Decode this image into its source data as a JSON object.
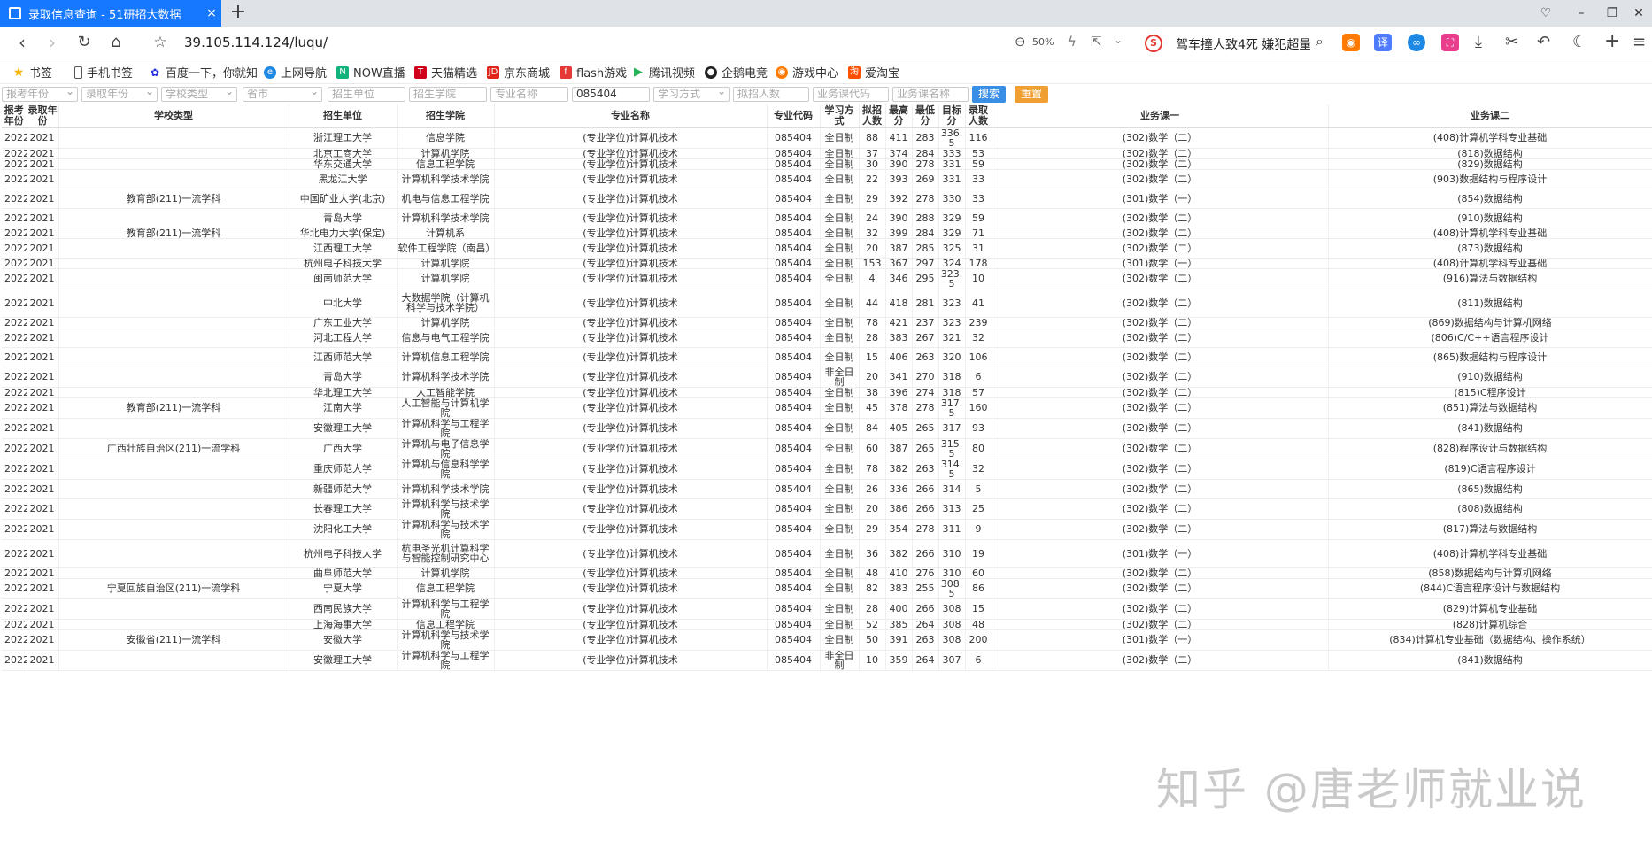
{
  "browser": {
    "tab_title": "录取信息查询 - 51研招大数据",
    "tab_close": "×",
    "new_tab": "+",
    "url": "39.105.114.124/luqu/",
    "zoom": "50%",
    "news": "驾车撞人致4死 嫌犯超量服",
    "window_controls": [
      "♡",
      "–",
      "❐",
      "✕"
    ]
  },
  "bookmarks": [
    {
      "label": "书签",
      "icon": "star-icon",
      "color": "#f5b301"
    },
    {
      "label": "手机书签",
      "icon": "phone-icon",
      "color": "#555555"
    },
    {
      "label": "百度一下，你就知",
      "icon": "baidu-icon",
      "color": "#2932e1"
    },
    {
      "label": "上网导航",
      "icon": "e-icon",
      "color": "#1e88e5"
    },
    {
      "label": "NOW直播",
      "icon": "now-icon",
      "color": "#11b27c"
    },
    {
      "label": "天猫精选",
      "icon": "tmall-icon",
      "color": "#d0021b"
    },
    {
      "label": "京东商城",
      "icon": "jd-icon",
      "color": "#e1251b"
    },
    {
      "label": "flash游戏",
      "icon": "flash-icon",
      "color": "#e53935"
    },
    {
      "label": "腾讯视频",
      "icon": "play-icon",
      "color": "#21b356"
    },
    {
      "label": "企鹅电竞",
      "icon": "penguin-icon",
      "color": "#222222"
    },
    {
      "label": "游戏中心",
      "icon": "gamepad-icon",
      "color": "#ff7a00"
    },
    {
      "label": "爱淘宝",
      "icon": "taobao-icon",
      "color": "#ff5000"
    }
  ],
  "filters": {
    "exam_year": "报考年份",
    "admit_year": "录取年份",
    "school_type": "学校类型",
    "province": "省市",
    "unit": "招生单位",
    "college": "招生学院",
    "major_name": "专业名称",
    "major_code": "085404",
    "study_mode": "学习方式",
    "planned": "拟招人数",
    "course_code": "业务课代码",
    "course_name": "业务课名称",
    "search": "搜索",
    "reset": "重置"
  },
  "table": {
    "headers": [
      "报考年份",
      "录取年份",
      "学校类型",
      "招生单位",
      "招生学院",
      "专业名称",
      "专业代码",
      "学习方式",
      "拟招人数",
      "最高分",
      "最低分",
      "目标分",
      "录取人数",
      "业务课一",
      "业务课二"
    ],
    "rows": [
      [
        "2022",
        "2021",
        "",
        "浙江理工大学",
        "信息学院",
        "(专业学位)计算机技术",
        "085404",
        "全日制",
        "88",
        "411",
        "283",
        "336.5",
        "116",
        "(302)数学（二）",
        "(408)计算机学科专业基础"
      ],
      [
        "2022",
        "2021",
        "",
        "北京工商大学",
        "计算机学院",
        "(专业学位)计算机技术",
        "085404",
        "全日制",
        "37",
        "374",
        "284",
        "333",
        "53",
        "(302)数学（二）",
        "(818)数据结构"
      ],
      [
        "2022",
        "2021",
        "",
        "华东交通大学",
        "信息工程学院",
        "(专业学位)计算机技术",
        "085404",
        "全日制",
        "30",
        "390",
        "278",
        "331",
        "59",
        "(302)数学（二）",
        "(829)数据结构"
      ],
      [
        "2022",
        "2021",
        "",
        "黑龙江大学",
        "计算机科学技术学院",
        "(专业学位)计算机技术",
        "085404",
        "全日制",
        "22",
        "393",
        "269",
        "331",
        "33",
        "(302)数学（二）",
        "(903)数据结构与程序设计"
      ],
      [
        "2022",
        "2021",
        "教育部(211)一流学科",
        "中国矿业大学(北京)",
        "机电与信息工程学院",
        "(专业学位)计算机技术",
        "085404",
        "全日制",
        "29",
        "392",
        "278",
        "330",
        "33",
        "(301)数学（一）",
        "(854)数据结构"
      ],
      [
        "2022",
        "2021",
        "",
        "青岛大学",
        "计算机科学技术学院",
        "(专业学位)计算机技术",
        "085404",
        "全日制",
        "24",
        "390",
        "288",
        "329",
        "59",
        "(302)数学（二）",
        "(910)数据结构"
      ],
      [
        "2022",
        "2021",
        "教育部(211)一流学科",
        "华北电力大学(保定)",
        "计算机系",
        "(专业学位)计算机技术",
        "085404",
        "全日制",
        "32",
        "399",
        "284",
        "329",
        "71",
        "(302)数学（二）",
        "(408)计算机学科专业基础"
      ],
      [
        "2022",
        "2021",
        "",
        "江西理工大学",
        "软件工程学院（南昌）",
        "(专业学位)计算机技术",
        "085404",
        "全日制",
        "20",
        "387",
        "285",
        "325",
        "31",
        "(302)数学（二）",
        "(873)数据结构"
      ],
      [
        "2022",
        "2021",
        "",
        "杭州电子科技大学",
        "计算机学院",
        "(专业学位)计算机技术",
        "085404",
        "全日制",
        "153",
        "367",
        "297",
        "324",
        "178",
        "(301)数学（一）",
        "(408)计算机学科专业基础"
      ],
      [
        "2022",
        "2021",
        "",
        "闽南师范大学",
        "计算机学院",
        "(专业学位)计算机技术",
        "085404",
        "全日制",
        "4",
        "346",
        "295",
        "323.5",
        "10",
        "(302)数学（二）",
        "(916)算法与数据结构"
      ],
      [
        "2022",
        "2021",
        "",
        "中北大学",
        "大数据学院（计算机科学与技术学院）",
        "(专业学位)计算机技术",
        "085404",
        "全日制",
        "44",
        "418",
        "281",
        "323",
        "41",
        "(302)数学（二）",
        "(811)数据结构"
      ],
      [
        "2022",
        "2021",
        "",
        "广东工业大学",
        "计算机学院",
        "(专业学位)计算机技术",
        "085404",
        "全日制",
        "78",
        "421",
        "237",
        "323",
        "239",
        "(302)数学（二）",
        "(869)数据结构与计算机网络"
      ],
      [
        "2022",
        "2021",
        "",
        "河北工程大学",
        "信息与电气工程学院",
        "(专业学位)计算机技术",
        "085404",
        "全日制",
        "28",
        "383",
        "267",
        "321",
        "32",
        "(302)数学（二）",
        "(806)C/C++语言程序设计"
      ],
      [
        "2022",
        "2021",
        "",
        "江西师范大学",
        "计算机信息工程学院",
        "(专业学位)计算机技术",
        "085404",
        "全日制",
        "15",
        "406",
        "263",
        "320",
        "106",
        "(302)数学（二）",
        "(865)数据结构与程序设计"
      ],
      [
        "2022",
        "2021",
        "",
        "青岛大学",
        "计算机科学技术学院",
        "(专业学位)计算机技术",
        "085404",
        "非全日制",
        "20",
        "341",
        "270",
        "318",
        "6",
        "(302)数学（二）",
        "(910)数据结构"
      ],
      [
        "2022",
        "2021",
        "",
        "华北理工大学",
        "人工智能学院",
        "(专业学位)计算机技术",
        "085404",
        "全日制",
        "38",
        "396",
        "274",
        "318",
        "57",
        "(302)数学（二）",
        "(815)C程序设计"
      ],
      [
        "2022",
        "2021",
        "教育部(211)一流学科",
        "江南大学",
        "人工智能与计算机学院",
        "(专业学位)计算机技术",
        "085404",
        "全日制",
        "45",
        "378",
        "278",
        "317.5",
        "160",
        "(302)数学（二）",
        "(851)算法与数据结构"
      ],
      [
        "2022",
        "2021",
        "",
        "安徽理工大学",
        "计算机科学与工程学院",
        "(专业学位)计算机技术",
        "085404",
        "全日制",
        "84",
        "405",
        "265",
        "317",
        "93",
        "(302)数学（二）",
        "(841)数据结构"
      ],
      [
        "2022",
        "2021",
        "广西壮族自治区(211)一流学科",
        "广西大学",
        "计算机与电子信息学院",
        "(专业学位)计算机技术",
        "085404",
        "全日制",
        "60",
        "387",
        "265",
        "315.5",
        "80",
        "(302)数学（二）",
        "(828)程序设计与数据结构"
      ],
      [
        "2022",
        "2021",
        "",
        "重庆师范大学",
        "计算机与信息科学学院",
        "(专业学位)计算机技术",
        "085404",
        "全日制",
        "78",
        "382",
        "263",
        "314.5",
        "32",
        "(302)数学（二）",
        "(819)C语言程序设计"
      ],
      [
        "2022",
        "2021",
        "",
        "新疆师范大学",
        "计算机科学技术学院",
        "(专业学位)计算机技术",
        "085404",
        "全日制",
        "26",
        "336",
        "266",
        "314",
        "5",
        "(302)数学（二）",
        "(865)数据结构"
      ],
      [
        "2022",
        "2021",
        "",
        "长春理工大学",
        "计算机科学与技术学院",
        "(专业学位)计算机技术",
        "085404",
        "全日制",
        "20",
        "386",
        "266",
        "313",
        "25",
        "(302)数学（二）",
        "(808)数据结构"
      ],
      [
        "2022",
        "2021",
        "",
        "沈阳化工大学",
        "计算机科学与技术学院",
        "(专业学位)计算机技术",
        "085404",
        "全日制",
        "29",
        "354",
        "278",
        "311",
        "9",
        "(302)数学（二）",
        "(817)算法与数据结构"
      ],
      [
        "2022",
        "2021",
        "",
        "杭州电子科技大学",
        "杭电圣光机计算科学与智能控制研究中心",
        "(专业学位)计算机技术",
        "085404",
        "全日制",
        "36",
        "382",
        "266",
        "310",
        "19",
        "(301)数学（一）",
        "(408)计算机学科专业基础"
      ],
      [
        "2022",
        "2021",
        "",
        "曲阜师范大学",
        "计算机学院",
        "(专业学位)计算机技术",
        "085404",
        "全日制",
        "48",
        "410",
        "276",
        "310",
        "60",
        "(302)数学（二）",
        "(858)数据结构与计算机网络"
      ],
      [
        "2022",
        "2021",
        "宁夏回族自治区(211)一流学科",
        "宁夏大学",
        "信息工程学院",
        "(专业学位)计算机技术",
        "085404",
        "全日制",
        "82",
        "383",
        "255",
        "308.5",
        "86",
        "(302)数学（二）",
        "(844)C语言程序设计与数据结构"
      ],
      [
        "2022",
        "2021",
        "",
        "西南民族大学",
        "计算机科学与工程学院",
        "(专业学位)计算机技术",
        "085404",
        "全日制",
        "28",
        "400",
        "266",
        "308",
        "15",
        "(302)数学（二）",
        "(829)计算机专业基础"
      ],
      [
        "2022",
        "2021",
        "",
        "上海海事大学",
        "信息工程学院",
        "(专业学位)计算机技术",
        "085404",
        "全日制",
        "52",
        "385",
        "264",
        "308",
        "48",
        "(302)数学（二）",
        "(828)计算机综合"
      ],
      [
        "2022",
        "2021",
        "安徽省(211)一流学科",
        "安徽大学",
        "计算机科学与技术学院",
        "(专业学位)计算机技术",
        "085404",
        "全日制",
        "50",
        "391",
        "263",
        "308",
        "200",
        "(301)数学（一）",
        "(834)计算机专业基础（数据结构、操作系统）"
      ],
      [
        "2022",
        "2021",
        "",
        "安徽理工大学",
        "计算机科学与工程学院",
        "(专业学位)计算机技术",
        "085404",
        "非全日制",
        "10",
        "359",
        "264",
        "307",
        "6",
        "(302)数学（二）",
        "(841)数据结构"
      ]
    ]
  },
  "watermark": "知乎 @唐老师就业说"
}
